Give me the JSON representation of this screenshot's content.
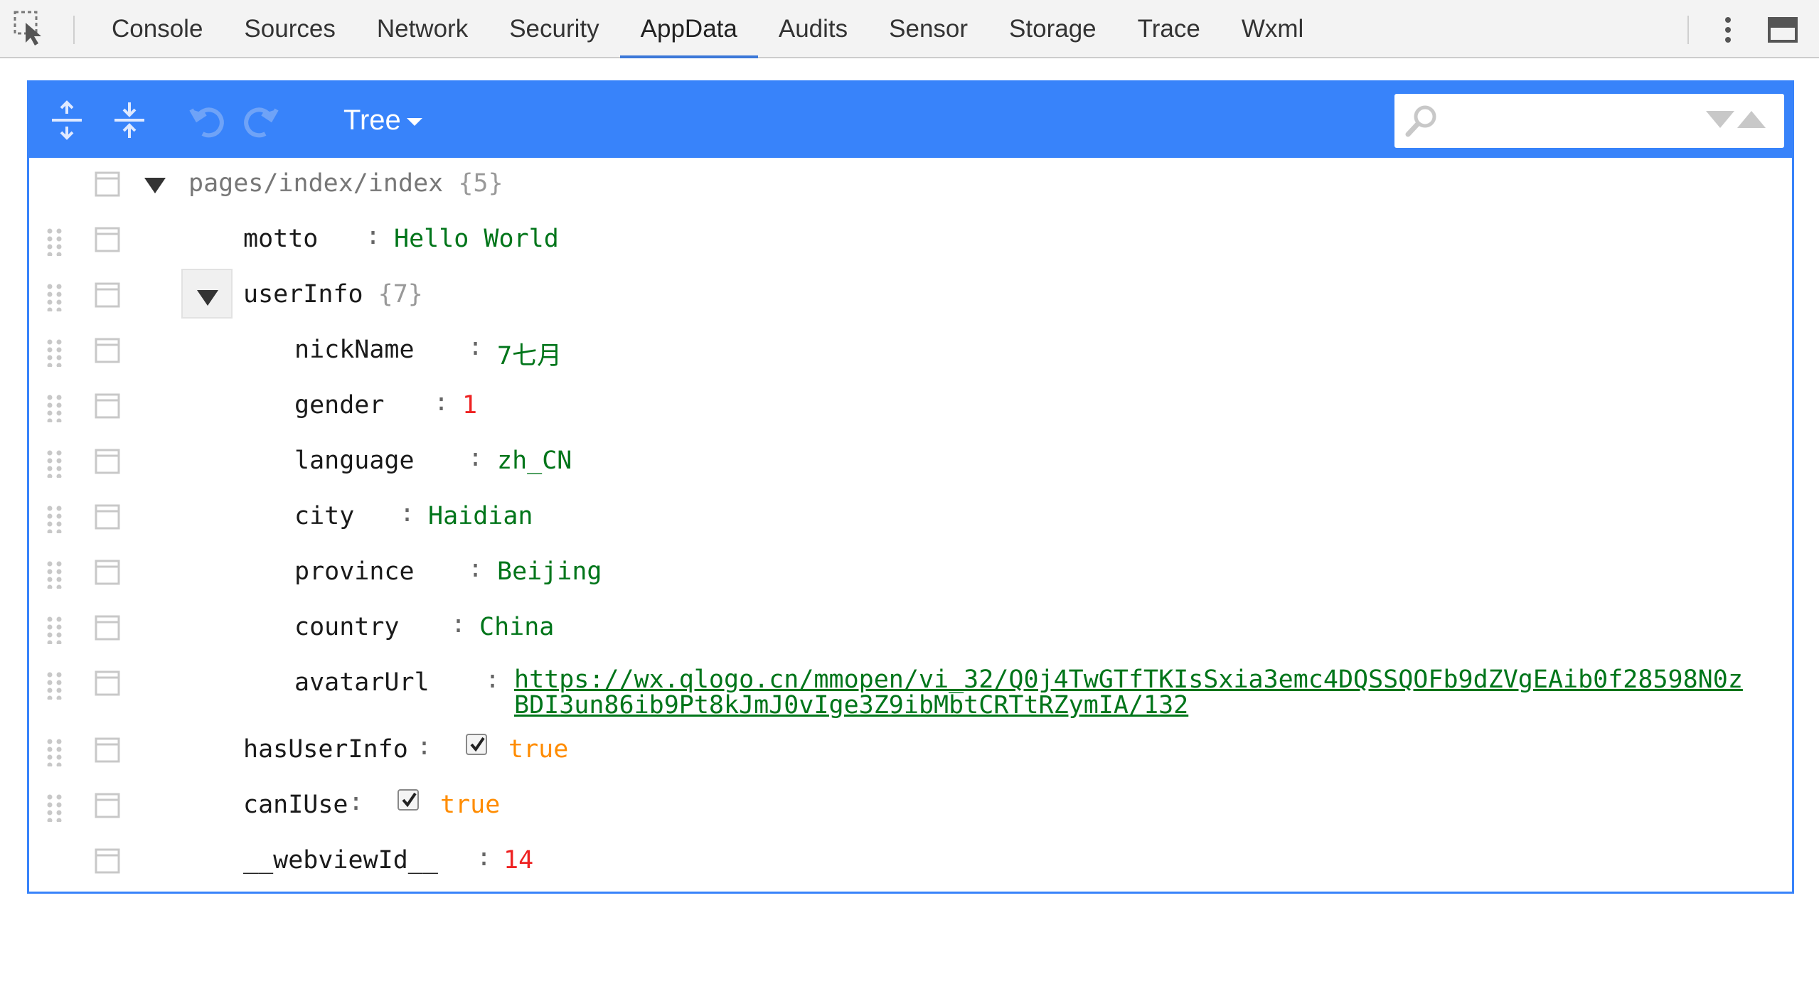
{
  "devtools": {
    "tabs": [
      "Console",
      "Sources",
      "Network",
      "Security",
      "AppData",
      "Audits",
      "Sensor",
      "Storage",
      "Trace",
      "Wxml"
    ],
    "active_tab": "AppData"
  },
  "editor": {
    "mode_label": "Tree",
    "search_placeholder": "",
    "accent_color": "#3883fa"
  },
  "tree": {
    "root": {
      "field": "pages/index/index",
      "count": "{5}"
    },
    "motto": {
      "field": "motto",
      "value": "Hello World"
    },
    "userInfo": {
      "field": "userInfo",
      "count": "{7}",
      "nickName": {
        "field": "nickName",
        "value": "7七月"
      },
      "gender": {
        "field": "gender",
        "value": "1"
      },
      "language": {
        "field": "language",
        "value": "zh_CN"
      },
      "city": {
        "field": "city",
        "value": "Haidian"
      },
      "province": {
        "field": "province",
        "value": "Beijing"
      },
      "country": {
        "field": "country",
        "value": "China"
      },
      "avatarUrl": {
        "field": "avatarUrl",
        "value": "https://wx.qlogo.cn/mmopen/vi_32/Q0j4TwGTfTKIsSxia3emc4DQSSQOFb9dZVgEAib0f28598N0zBDI3un86ib9Pt8kJmJ0vIge3Z9ibMbtCRTtRZymIA/132"
      }
    },
    "hasUserInfo": {
      "field": "hasUserInfo",
      "value": "true"
    },
    "canIUse": {
      "field": "canIUse",
      "value": "true"
    },
    "webviewId": {
      "field": "__webviewId__",
      "value": "14"
    }
  }
}
